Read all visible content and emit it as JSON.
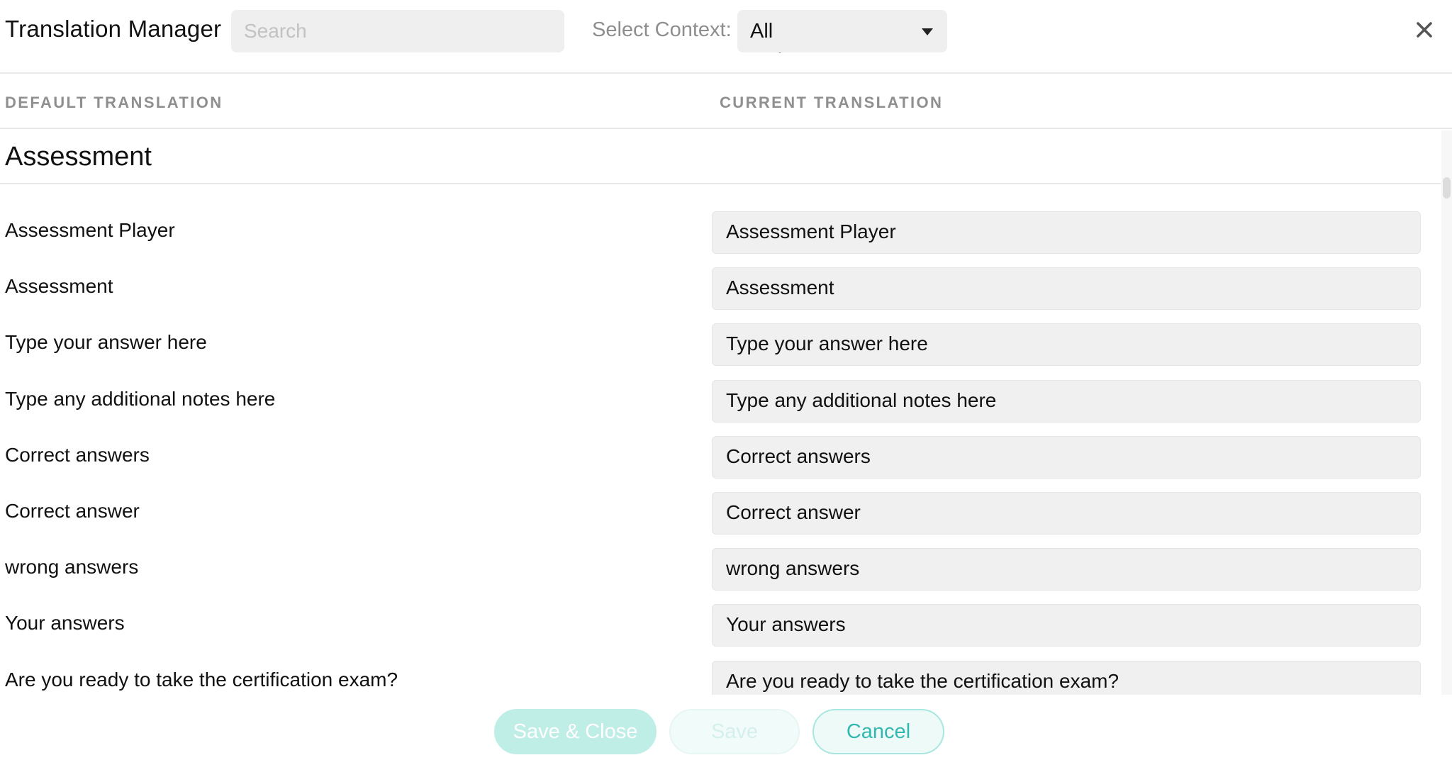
{
  "header": {
    "title": "Translation Manager",
    "search_placeholder": "Search",
    "context_label": "Select Context:",
    "context_value": "All"
  },
  "columns": {
    "default_label": "DEFAULT TRANSLATION",
    "current_label": "CURRENT TRANSLATION"
  },
  "section": {
    "title": "Assessment"
  },
  "rows": [
    {
      "default": "Assessment Player",
      "current": "Assessment Player"
    },
    {
      "default": "Assessment",
      "current": "Assessment"
    },
    {
      "default": "Type your answer here",
      "current": "Type your answer here"
    },
    {
      "default": "Type any additional notes here",
      "current": "Type any additional notes here"
    },
    {
      "default": "Correct answers",
      "current": "Correct answers"
    },
    {
      "default": "Correct answer",
      "current": "Correct answer"
    },
    {
      "default": "wrong answers",
      "current": "wrong answers"
    },
    {
      "default": "Your answers",
      "current": "Your answers"
    },
    {
      "default": "Are you ready to take the certification exam?",
      "current": "Are you ready to take the certification exam?"
    }
  ],
  "footer": {
    "save_close_label": "Save & Close",
    "save_label": "Save",
    "cancel_label": "Cancel"
  },
  "colors": {
    "accent": "#33b8b0",
    "accent_light": "#bfeee7",
    "field_bg": "#f0f0f0"
  },
  "icons": {
    "search": "search-icon",
    "dropdown": "chevron-down-icon",
    "close": "close-icon"
  }
}
